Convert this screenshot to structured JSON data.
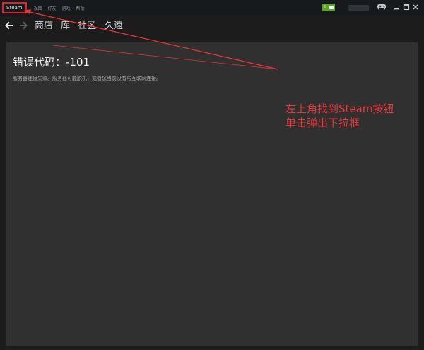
{
  "titlebar": {
    "menu": [
      {
        "label": "Steam",
        "name": "menu-steam"
      },
      {
        "label": "视图",
        "name": "menu-view"
      },
      {
        "label": "好友",
        "name": "menu-friends"
      },
      {
        "label": "游戏",
        "name": "menu-games"
      },
      {
        "label": "帮助",
        "name": "menu-help"
      }
    ],
    "notification_count": "1",
    "icons": {
      "controller": "controller-icon",
      "minimize": "minimize-icon",
      "maximize": "maximize-icon",
      "close": "close-icon",
      "notification": "envelope-icon"
    }
  },
  "nav": {
    "back_icon": "arrow-left-icon",
    "forward_icon": "arrow-right-icon",
    "tabs": [
      "商店",
      "库",
      "社区",
      "久遠"
    ]
  },
  "main": {
    "error_title": "错误代码：-101",
    "error_desc": "服务器连接失败。服务器可能脱机，或者您当前没有与互联网连接。"
  },
  "annotation": {
    "lines": [
      "左上角找到Steam按钮",
      "单击弹出下拉框"
    ],
    "color": "#e5363a"
  },
  "colors": {
    "background": "#1c1c1c",
    "panel": "#303030",
    "titlebar": "#171a1d",
    "highlight": "#e2222a",
    "notification": "#5ba32b"
  }
}
